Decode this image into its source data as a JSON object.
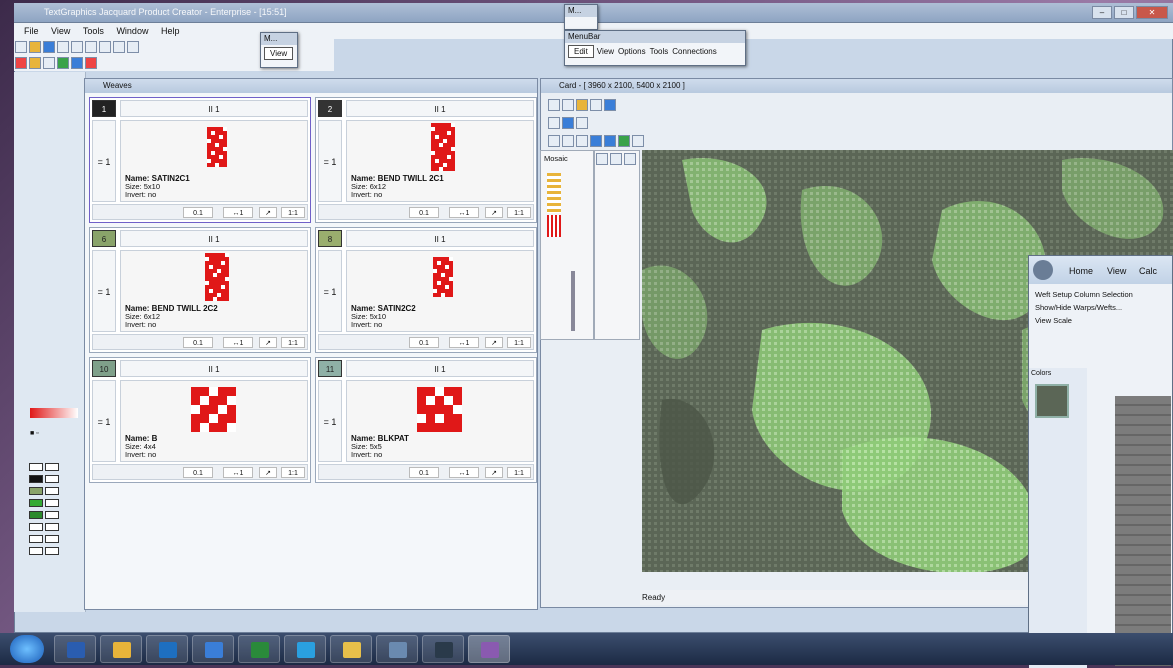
{
  "app": {
    "title": "TextGraphics Jacquard Product Creator - Enterprise - [15:51]",
    "menu": [
      "File",
      "View",
      "Tools",
      "Window",
      "Help"
    ]
  },
  "float_view": {
    "title": "M...",
    "button": "View"
  },
  "float_menubar": {
    "title": "M...",
    "header": "MenuBar",
    "items": [
      "Edit",
      "View",
      "Options",
      "Tools",
      "Connections"
    ]
  },
  "weaves_window": {
    "title": "Weaves",
    "cells": [
      {
        "number": "1",
        "top": "II 1",
        "side": "= 1",
        "name": "Name: SATIN2C1",
        "size": "Size: 5x10",
        "invert": "Invert: no",
        "foot": [
          "0.1",
          "↔1",
          "↗",
          "1:1"
        ],
        "num_color": "#222222"
      },
      {
        "number": "2",
        "top": "II 1",
        "side": "= 1",
        "name": "Name: BEND TWILL 2C1",
        "size": "Size: 6x12",
        "invert": "Invert: no",
        "foot": [
          "0.1",
          "↔1",
          "↗",
          "1:1"
        ],
        "num_color": "#333333"
      },
      {
        "number": "6",
        "top": "II 1",
        "side": "= 1",
        "name": "Name: BEND TWILL 2C2",
        "size": "Size: 6x12",
        "invert": "Invert: no",
        "foot": [
          "0.1",
          "↔1",
          "↗",
          "1:1"
        ],
        "num_color": "#8aa36a"
      },
      {
        "number": "8",
        "top": "II 1",
        "side": "= 1",
        "name": "Name: SATIN2C2",
        "size": "Size: 5x10",
        "invert": "Invert: no",
        "foot": [
          "0.1",
          "↔1",
          "↗",
          "1:1"
        ],
        "num_color": "#9aae6e"
      },
      {
        "number": "10",
        "top": "II 1",
        "side": "= 1",
        "name": "Name: B",
        "size": "Size: 4x4",
        "invert": "Invert: no",
        "foot": [
          "0.1",
          "↔1",
          "↗",
          "1:1"
        ],
        "num_color": "#7fa08a"
      },
      {
        "number": "11",
        "top": "II 1",
        "side": "= 1",
        "name": "Name: BLKPAT",
        "size": "Size: 5x5",
        "invert": "Invert: no",
        "foot": [
          "0.1",
          "↔1",
          "↗",
          "1:1"
        ],
        "num_color": "#8fb0a6"
      }
    ]
  },
  "card_window": {
    "title": "Card - [ 3960 x 2100, 5400 x 2100 ]",
    "mode_label": "Mosaic",
    "status": "Ready"
  },
  "right_panel": {
    "tabs": [
      "Home",
      "View",
      "Calc"
    ],
    "items": [
      "Weft Setup Column Selection",
      "Show/Hide Warps/Wefts...",
      "View Scale"
    ],
    "section": "Colors"
  },
  "colors": {
    "canvas_dark": "#5b6656",
    "canvas_light": "#8fcb78",
    "weave_red": "#e01818",
    "accent": "#7060c8"
  },
  "taskbar": {
    "apps": [
      "word-icon",
      "folder-icon",
      "outlook-icon",
      "network-icon",
      "excel-icon",
      "ie-icon",
      "explorer-icon",
      "printer-icon",
      "shell-icon",
      "textgraphics-icon"
    ]
  }
}
